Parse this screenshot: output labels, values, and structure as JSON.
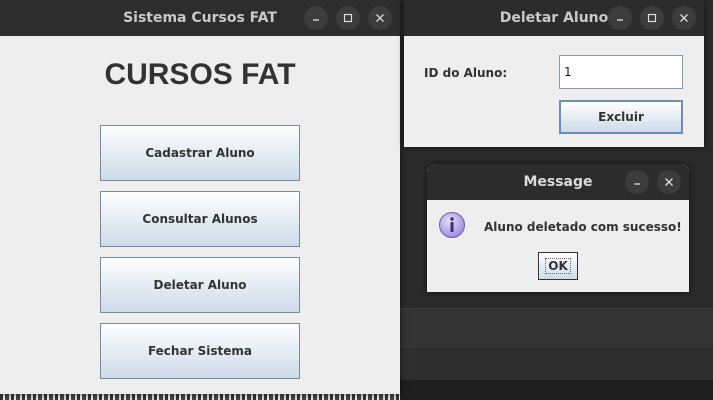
{
  "main_window": {
    "title": "Sistema Cursos FAT",
    "heading": "CURSOS FAT",
    "buttons": [
      {
        "label": "Cadastrar Aluno"
      },
      {
        "label": "Consultar Alunos"
      },
      {
        "label": "Deletar Aluno"
      },
      {
        "label": "Fechar Sistema"
      }
    ]
  },
  "delete_window": {
    "title": "Deletar Aluno",
    "id_label": "ID do Aluno:",
    "id_value": "1",
    "excluir_label": "Excluir"
  },
  "message_dialog": {
    "title": "Message",
    "text": "Aluno deletado com sucesso!",
    "ok_label": "OK"
  },
  "icons": {
    "minimize": "minimize-icon",
    "maximize": "maximize-icon",
    "close": "close-icon",
    "info": "info-icon"
  },
  "colors": {
    "titlebar": "#2c2c2c",
    "window_bg": "#eeeeee",
    "info_icon": "#8f7fd6"
  }
}
